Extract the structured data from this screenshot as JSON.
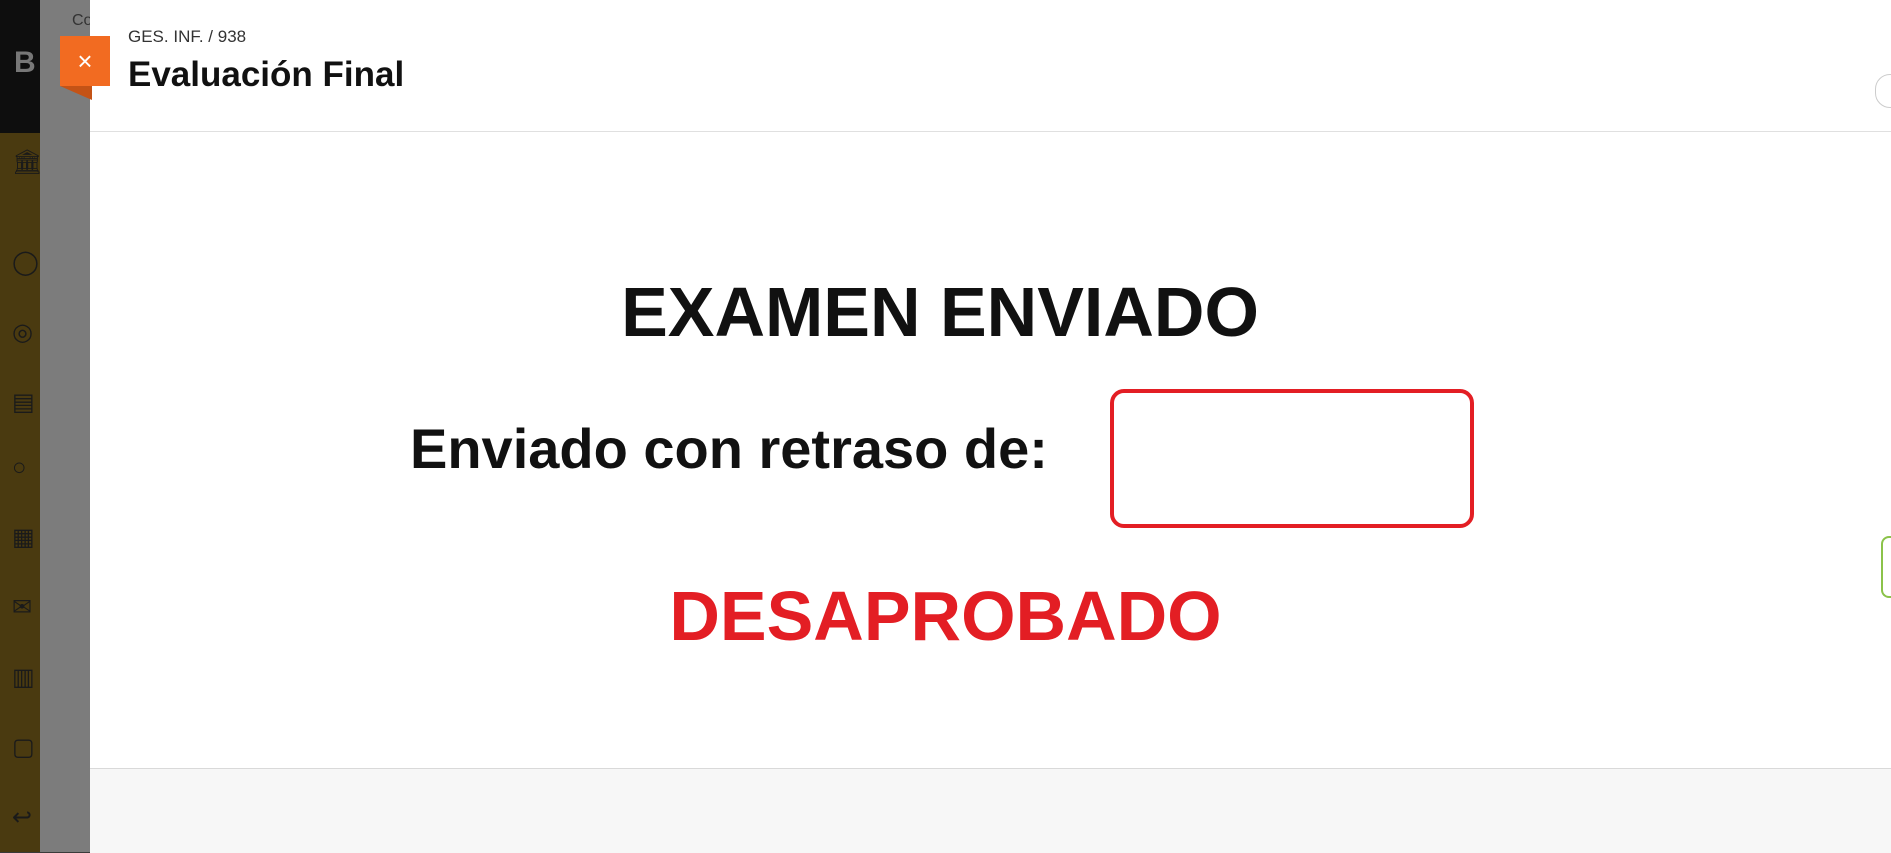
{
  "background": {
    "logo_letter": "B",
    "crumb_fragment": "Co"
  },
  "panel": {
    "breadcrumb": "GES. INF. / 938",
    "title": "Evaluación Final",
    "close_icon": "×"
  },
  "content": {
    "heading": "EXAMEN ENVIADO",
    "delay_label": "Enviado con retraso de:",
    "delay_value": "",
    "status": "DESAPROBADO"
  },
  "colors": {
    "accent_orange": "#f26b21",
    "status_red": "#e31e24"
  },
  "icons": [
    "bank-icon",
    "user-icon",
    "globe-icon",
    "courses-icon",
    "groups-icon",
    "calendar-icon",
    "mail-icon",
    "grades-icon",
    "edit-icon",
    "logout-icon"
  ]
}
